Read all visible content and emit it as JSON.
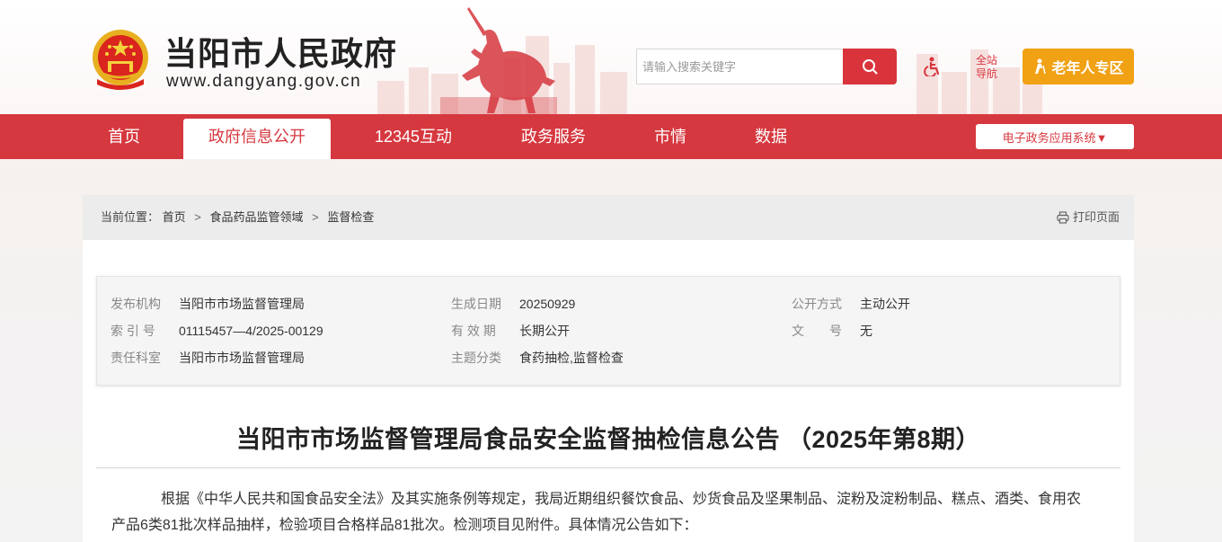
{
  "header": {
    "site_title": "当阳市人民政府",
    "site_url": "www.dangyang.gov.cn",
    "search_placeholder": "请输入搜索关键字",
    "guide_line1": "全站",
    "guide_line2": "导航",
    "elder_label": "老年人专区"
  },
  "nav": {
    "items": [
      {
        "label": "首页"
      },
      {
        "label": "政府信息公开",
        "active": true
      },
      {
        "label": "12345互动"
      },
      {
        "label": "政务服务"
      },
      {
        "label": "市情"
      },
      {
        "label": "数据"
      }
    ],
    "system_label": "电子政务应用系统▼"
  },
  "breadcrumb": {
    "prefix": "当前位置：",
    "items": [
      "首页",
      "食品药品监管领域",
      "监督检查"
    ],
    "separator": ">",
    "print_label": "打印页面"
  },
  "meta": {
    "publisher_label": "发布机构",
    "publisher": "当阳市市场监督管理局",
    "date_label": "生成日期",
    "date": "20250929",
    "mode_label": "公开方式",
    "mode": "主动公开",
    "index_label": "索 引 号",
    "index": "01115457—4/2025-00129",
    "validity_label": "有 效 期",
    "validity": "长期公开",
    "docno_label": "文　　号",
    "docno": "无",
    "dept_label": "责任科室",
    "dept": "当阳市市场监督管理局",
    "topic_label": "主题分类",
    "topic": "食药抽检,监督检查"
  },
  "article": {
    "title": "当阳市市场监督管理局食品安全监督抽检信息公告 （2025年第8期）",
    "body_line1": "根据《中华人民共和国食品安全法》及其实施条例等规定，我局近期组织餐饮食品、炒货食品及坚果制品、淀粉及淀粉制品、糕点、酒类、食用农",
    "body_line2": "产品6类81批次样品抽样，检验项目合格样品81批次。检测项目见附件。具体情况公告如下："
  },
  "colors": {
    "brand_red": "#d6383f",
    "elder_orange": "#f0a114"
  },
  "icons": {
    "search": "search-icon",
    "accessibility": "wheelchair-icon",
    "elder": "elder-person-icon",
    "print": "printer-icon",
    "emblem": "national-emblem-icon"
  }
}
